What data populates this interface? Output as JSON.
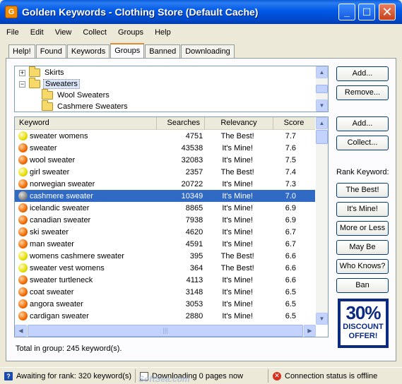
{
  "window": {
    "title": "Golden Keywords - Clothing Store (Default Cache)",
    "app_icon_glyph": "G",
    "minimize_glyph": "_",
    "maximize_glyph": "☐",
    "close_glyph": "✕"
  },
  "menu": [
    "File",
    "Edit",
    "View",
    "Collect",
    "Groups",
    "Help"
  ],
  "tabs": [
    "Help!",
    "Found",
    "Keywords",
    "Groups",
    "Banned",
    "Downloading"
  ],
  "active_tab": "Groups",
  "tree": {
    "items": [
      {
        "label": "Skirts",
        "expander": "+",
        "level": 0
      },
      {
        "label": "Sweaters",
        "expander": "−",
        "level": 0,
        "selected": true
      },
      {
        "label": "Wool Sweaters",
        "level": 1
      },
      {
        "label": "Cashmere Sweaters",
        "level": 1
      }
    ]
  },
  "group_buttons": {
    "add": "Add...",
    "remove": "Remove..."
  },
  "keyword_buttons": {
    "add": "Add...",
    "collect": "Collect..."
  },
  "rank": {
    "label": "Rank Keyword:",
    "buttons": [
      "The Best!",
      "It's Mine!",
      "More or Less",
      "May Be",
      "Who Knows?",
      "Ban"
    ]
  },
  "table": {
    "columns": [
      "Keyword",
      "Searches",
      "Relevancy",
      "Score"
    ],
    "rows": [
      {
        "icon": "yellow",
        "keyword": "sweater womens",
        "searches": "4751",
        "relevancy": "The Best!",
        "score": "7.7"
      },
      {
        "icon": "orange",
        "keyword": "sweater",
        "searches": "43538",
        "relevancy": "It's Mine!",
        "score": "7.6"
      },
      {
        "icon": "orange",
        "keyword": "wool sweater",
        "searches": "32083",
        "relevancy": "It's Mine!",
        "score": "7.5"
      },
      {
        "icon": "yellow",
        "keyword": "girl sweater",
        "searches": "2357",
        "relevancy": "The Best!",
        "score": "7.4"
      },
      {
        "icon": "orange",
        "keyword": "norwegian sweater",
        "searches": "20722",
        "relevancy": "It's Mine!",
        "score": "7.3"
      },
      {
        "icon": "gray",
        "keyword": "cashmere sweater",
        "searches": "10349",
        "relevancy": "It's Mine!",
        "score": "7.0",
        "selected": true
      },
      {
        "icon": "orange",
        "keyword": "icelandic sweater",
        "searches": "8865",
        "relevancy": "It's Mine!",
        "score": "6.9"
      },
      {
        "icon": "orange",
        "keyword": "canadian sweater",
        "searches": "7938",
        "relevancy": "It's Mine!",
        "score": "6.9"
      },
      {
        "icon": "orange",
        "keyword": "ski sweater",
        "searches": "4620",
        "relevancy": "It's Mine!",
        "score": "6.7"
      },
      {
        "icon": "orange",
        "keyword": "man sweater",
        "searches": "4591",
        "relevancy": "It's Mine!",
        "score": "6.7"
      },
      {
        "icon": "yellow",
        "keyword": "womens cashmere sweater",
        "searches": "395",
        "relevancy": "The Best!",
        "score": "6.6"
      },
      {
        "icon": "yellow",
        "keyword": "sweater vest womens",
        "searches": "364",
        "relevancy": "The Best!",
        "score": "6.6"
      },
      {
        "icon": "orange",
        "keyword": "sweater turtleneck",
        "searches": "4113",
        "relevancy": "It's Mine!",
        "score": "6.6"
      },
      {
        "icon": "orange",
        "keyword": "coat sweater",
        "searches": "3148",
        "relevancy": "It's Mine!",
        "score": "6.5"
      },
      {
        "icon": "orange",
        "keyword": "angora sweater",
        "searches": "3053",
        "relevancy": "It's Mine!",
        "score": "6.5"
      },
      {
        "icon": "orange",
        "keyword": "cardigan sweater",
        "searches": "2880",
        "relevancy": "It's Mine!",
        "score": "6.5"
      }
    ]
  },
  "total": "Total in group: 245 keyword(s).",
  "ad": {
    "big": "30%",
    "line1": "DISCOUNT",
    "line2": "OFFER!"
  },
  "status": {
    "awaiting": "Awaiting for rank: 320 keyword(s)",
    "downloading": "Downloading 0 pages now",
    "connection": "Connection status is offline"
  },
  "watermark": "SoftSea.com"
}
